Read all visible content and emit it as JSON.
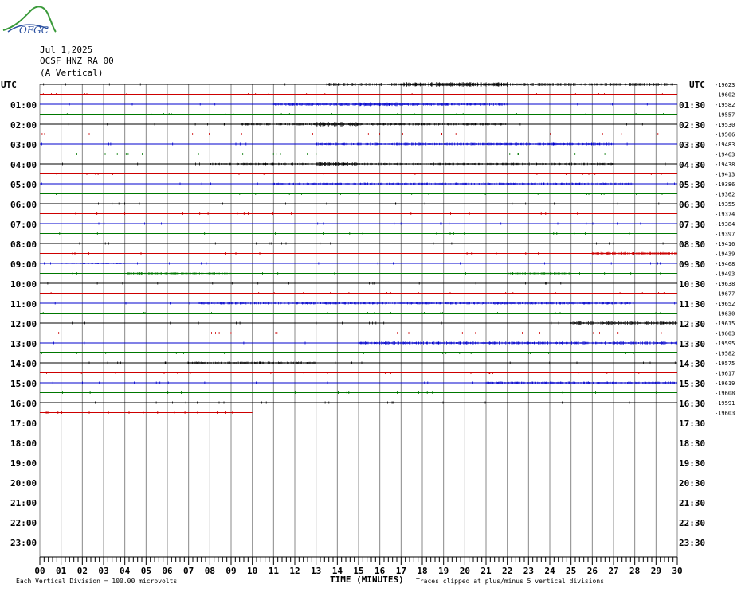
{
  "header": {
    "logo_text": "OFGC",
    "date": "Jul 1,2025",
    "station": "OCSF HNZ RA 00",
    "component": "(A Vertical)"
  },
  "axes": {
    "left_label": "UTC",
    "right_label": "UTC",
    "x_title": "TIME (MINUTES)",
    "x_ticks": [
      "00",
      "01",
      "02",
      "03",
      "04",
      "05",
      "06",
      "07",
      "08",
      "09",
      "10",
      "11",
      "12",
      "13",
      "14",
      "15",
      "16",
      "17",
      "18",
      "19",
      "20",
      "21",
      "22",
      "23",
      "24",
      "25",
      "26",
      "27",
      "28",
      "29",
      "30"
    ],
    "left_hours": [
      "",
      "01:00",
      "02:00",
      "03:00",
      "04:00",
      "05:00",
      "06:00",
      "07:00",
      "08:00",
      "09:00",
      "10:00",
      "11:00",
      "12:00",
      "13:00",
      "14:00",
      "15:00",
      "16:00",
      "17:00",
      "18:00",
      "19:00",
      "20:00",
      "21:00",
      "22:00",
      "23:00"
    ],
    "right_hours": [
      "",
      "01:30",
      "02:30",
      "03:30",
      "04:30",
      "05:30",
      "06:30",
      "07:30",
      "08:30",
      "09:30",
      "10:30",
      "11:30",
      "12:30",
      "13:30",
      "14:30",
      "15:30",
      "16:30",
      "17:30",
      "18:30",
      "19:30",
      "20:30",
      "21:30",
      "22:30",
      "23:30"
    ]
  },
  "footer": {
    "scale_note": "Each Vertical Division =  100.00 microvolts",
    "clip_note": "Traces clipped at plus/minus 5 vertical divisions"
  },
  "colors": {
    "trace_cycle": [
      "#000000",
      "#cc0000",
      "#0000cc",
      "#007700"
    ],
    "grid": "#888888"
  },
  "chart_data": {
    "type": "line",
    "title": "",
    "xlabel": "TIME (MINUTES)",
    "xlim": [
      0,
      30
    ],
    "trace_minutes": 30,
    "filled_traces": 34,
    "last_trace_end_minute": 10,
    "trace_offsets": [
      -19623,
      -19602,
      -19582,
      -19557,
      -19530,
      -19506,
      -19483,
      -19463,
      -19438,
      -19413,
      -19386,
      -19362,
      -19355,
      -19374,
      -19384,
      -19397,
      -19416,
      -19439,
      -19468,
      -19493,
      -19638,
      -19677,
      -19652,
      -19630,
      -19615,
      -19603,
      -19595,
      -19582,
      -19575,
      -19617,
      -19619,
      -19608,
      -19591,
      -19603
    ],
    "activity": [
      [
        [
          13.5,
          30,
          1.5
        ],
        [
          17,
          22,
          2.2
        ]
      ],
      [],
      [
        [
          11,
          22,
          1.5
        ],
        [
          15,
          17,
          2.0
        ]
      ],
      [],
      [
        [
          9.5,
          22,
          1.2
        ],
        [
          13,
          15,
          2.2
        ]
      ],
      [],
      [
        [
          13,
          27,
          1.2
        ]
      ],
      [],
      [
        [
          8,
          27,
          1.0
        ],
        [
          13,
          15,
          2.0
        ]
      ],
      [],
      [
        [
          11,
          28,
          1.0
        ]
      ],
      [],
      [],
      [],
      [],
      [],
      [],
      [
        [
          26,
          30,
          1.4
        ]
      ],
      [
        [
          1,
          4,
          0.8
        ]
      ],
      [
        [
          4,
          9,
          1.0
        ],
        [
          22,
          25,
          1.0
        ]
      ],
      [],
      [],
      [
        [
          7.5,
          28,
          1.2
        ]
      ],
      [],
      [
        [
          25,
          30,
          1.6
        ]
      ],
      [],
      [
        [
          15,
          30,
          1.4
        ]
      ],
      [],
      [
        [
          7,
          13,
          1.2
        ]
      ],
      [],
      [
        [
          21,
          30,
          1.2
        ]
      ],
      [],
      [],
      []
    ]
  }
}
